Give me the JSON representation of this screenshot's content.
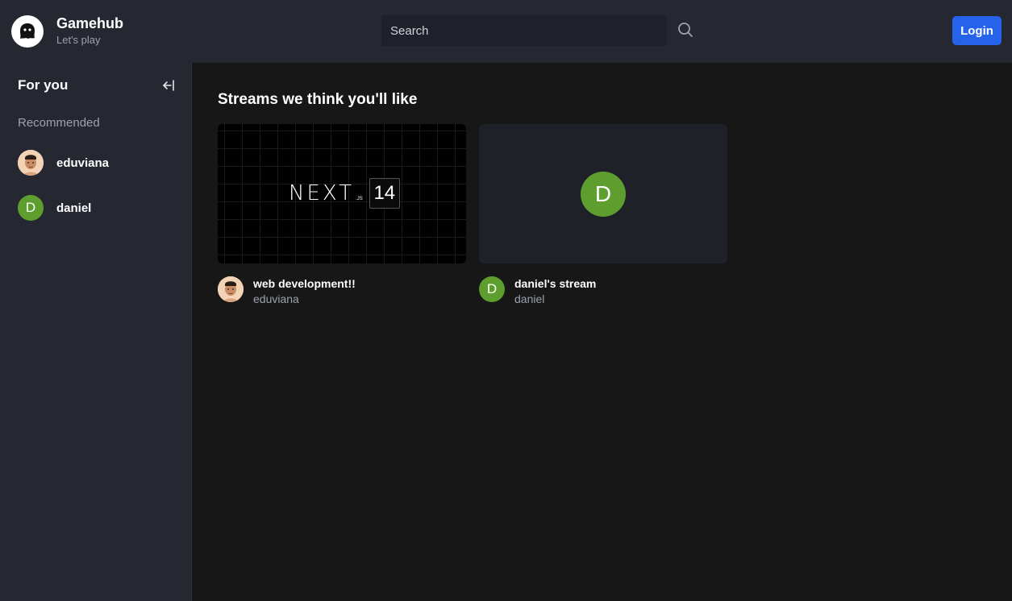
{
  "header": {
    "brand_title": "Gamehub",
    "brand_subtitle": "Let's play",
    "search_placeholder": "Search",
    "login_label": "Login",
    "logo_icon": "ghost-icon",
    "search_icon": "search-icon"
  },
  "sidebar": {
    "title": "For you",
    "collapse_icon": "arrow-left-to-line-icon",
    "recommended_label": "Recommended",
    "users": [
      {
        "name": "eduviana",
        "avatar": "photo"
      },
      {
        "name": "daniel",
        "avatar_letter": "D"
      }
    ]
  },
  "main": {
    "title": "Streams we think you'll like",
    "streams": [
      {
        "title": "web development!!",
        "user": "eduviana",
        "thumbnail_word": "NEXT",
        "thumbnail_suffix": ".JS",
        "thumbnail_version": "14"
      },
      {
        "title": "daniel's stream",
        "user": "daniel",
        "avatar_letter": "D"
      }
    ]
  },
  "colors": {
    "accent": "#2563eb",
    "avatar_green": "#5d9e2f",
    "header_bg": "#252731",
    "page_bg": "#171717"
  }
}
